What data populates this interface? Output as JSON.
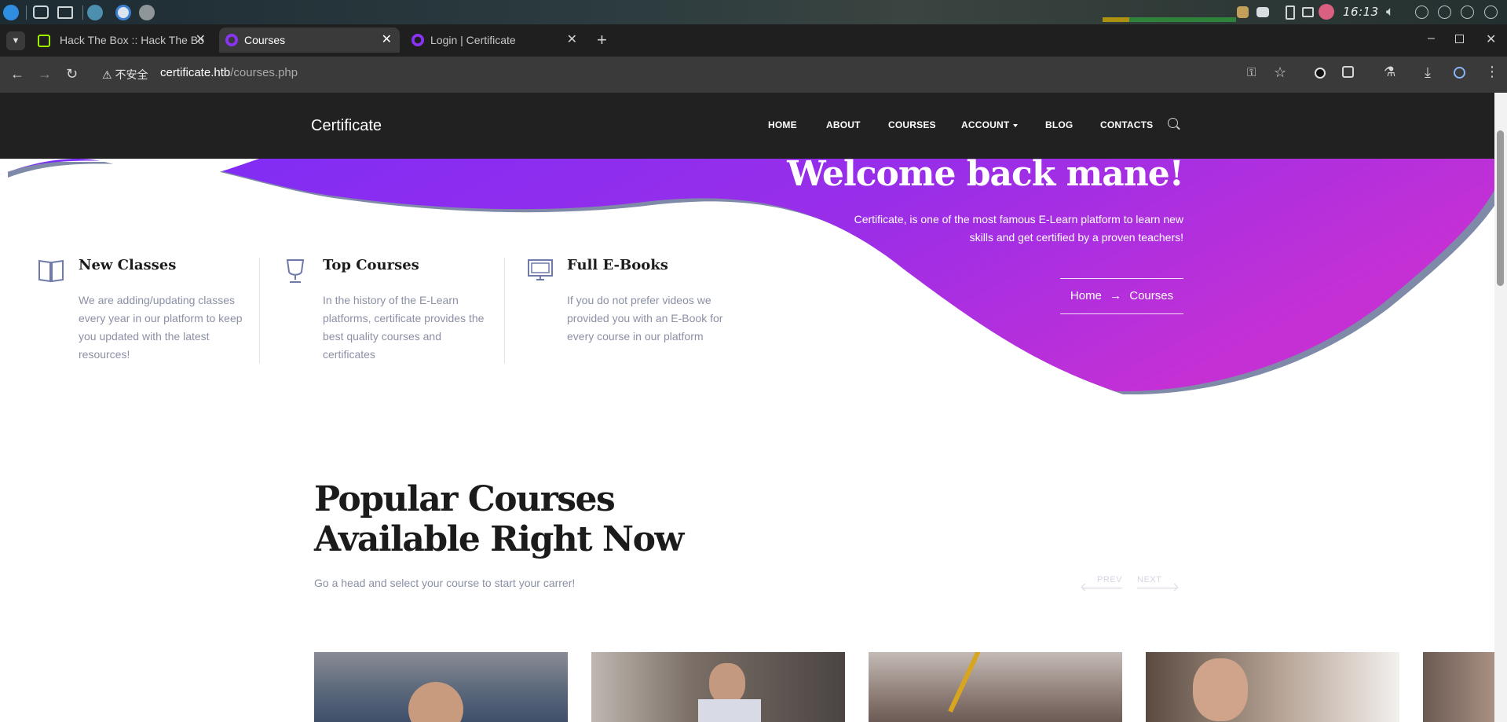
{
  "os": {
    "clock": "16:13"
  },
  "browser": {
    "tabs": [
      {
        "title": "Hack The Box :: Hack The Bo",
        "active": false
      },
      {
        "title": "Courses",
        "active": true
      },
      {
        "title": "Login | Certificate",
        "active": false
      }
    ],
    "address": {
      "security_label": "不安全",
      "host": "certificate.htb",
      "path": "/courses.php"
    }
  },
  "site": {
    "brand": "Certificate",
    "nav": [
      "HOME",
      "ABOUT",
      "COURSES",
      "ACCOUNT",
      "BLOG",
      "CONTACTS"
    ],
    "hero": {
      "title": "Welcome back mane!",
      "description": "Certificate, is one of the most famous E-Learn platform to learn new skills and get certified by a proven teachers!",
      "breadcrumb": {
        "home": "Home",
        "current": "Courses"
      }
    },
    "features": [
      {
        "icon": "book-icon",
        "title": "New Classes",
        "text": "We are adding/updating classes every year in our platform to keep you updated with the latest resources!"
      },
      {
        "icon": "trophy-icon",
        "title": "Top Courses",
        "text": "In the history of the E-Learn platforms, certificate provides the best quality courses and certificates"
      },
      {
        "icon": "monitor-icon",
        "title": "Full E-Books",
        "text": "If you do not prefer videos we provided you with an E-Book for every course in our platform"
      }
    ],
    "popular": {
      "title": "Popular Courses Available Right Now",
      "subtitle": "Go a head and select your course to start your carrer!",
      "prev": "PREV",
      "next": "NEXT"
    }
  },
  "colors": {
    "accent_purple": "#8a33f5",
    "accent_magenta": "#b52fd8",
    "nav_bg": "#212121",
    "muted_text": "#8b90a5"
  }
}
